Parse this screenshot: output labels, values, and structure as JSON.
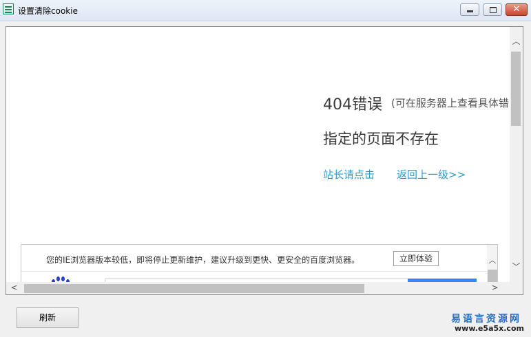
{
  "window": {
    "title": "设置清除cookie",
    "close_glyph": "✕"
  },
  "page": {
    "error_code": "404错误",
    "error_note": "(可在服务器上查看具体错",
    "error_message": "指定的页面不存在",
    "link_admin": "站长请点击",
    "link_back": "返回上一级>>",
    "link_color": "#2a9bd1"
  },
  "notice": {
    "text": "您的IE浏览器版本较低，即将停止更新维护，建议升级到更快、更安全的百度浏览器。",
    "button": "立即体验"
  },
  "scroll": {
    "up": "︿",
    "down": "﹀",
    "left": "<",
    "right": ">"
  },
  "footer": {
    "refresh_label": "刷新",
    "brand_cn": "易语言资源网",
    "brand_url": "www.e5a5x.com"
  }
}
